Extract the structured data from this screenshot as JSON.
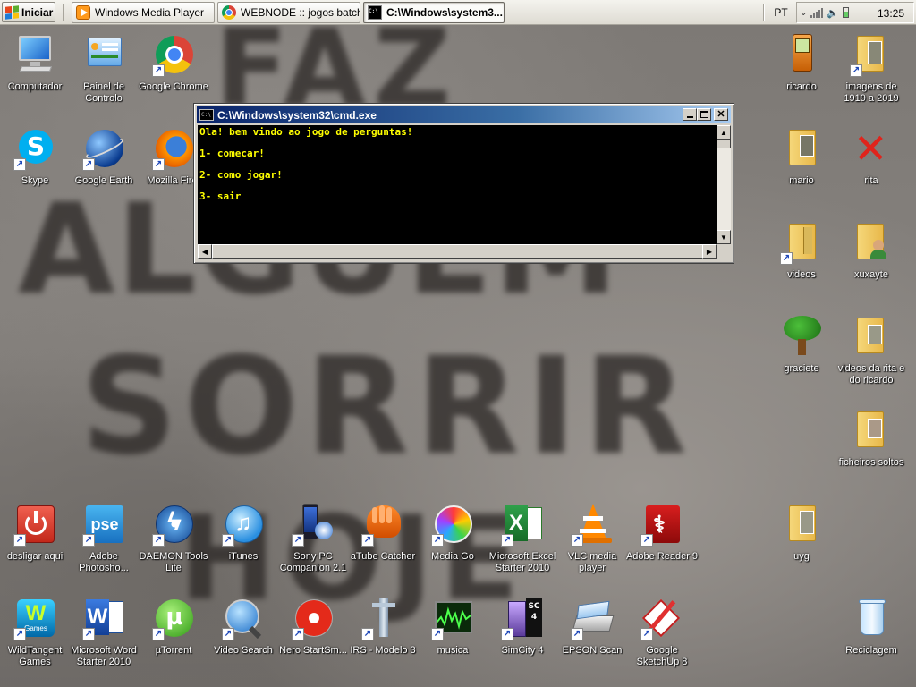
{
  "taskbar": {
    "start_label": "Iniciar",
    "tasks": [
      {
        "label": "Windows Media Player",
        "icon": "windows-media-player-icon"
      },
      {
        "label": "WEBNODE :: jogos batch...",
        "icon": "chrome-icon"
      },
      {
        "label": "C:\\Windows\\system3...",
        "icon": "cmd-icon"
      }
    ],
    "language": "PT",
    "clock": "13:25"
  },
  "wallpaper_words": [
    "FAZ",
    "ALGUEM",
    "SORRIR",
    "HOJE"
  ],
  "cmd_window": {
    "title": "C:\\Windows\\system32\\cmd.exe",
    "title_icon_text": "C:\\",
    "lines": [
      "Ola! bem vindo ao jogo de perguntas!",
      "1- comecar!",
      "2- como jogar!",
      "3- sair"
    ],
    "text_color": "#ffff00",
    "background_color": "#000000"
  },
  "desktop_icons": {
    "computador": "Computador",
    "painel": "Painel de Controlo",
    "chrome": "Google Chrome",
    "skype": "Skype",
    "earth": "Google Earth",
    "firefox": "Mozilla Firef",
    "ricardo": "ricardo",
    "imagens": "imagens de 1919 a 2019",
    "mario": "mario",
    "rita": "rita",
    "videos": "videos",
    "xuxayte": "xuxayte",
    "graciete": "graciete",
    "videos_rita": "videos da rita e do ricardo",
    "ficheiros": "ficheiros soltos",
    "uyg": "uyg",
    "desligar": "desligar aqui",
    "photoshop": "Adobe Photosho...",
    "daemon": "DAEMON Tools Lite",
    "itunes": "iTunes",
    "sony": "Sony PC Companion 2.1",
    "atube": "aTube Catcher",
    "mediago": "Media Go",
    "excel": "Microsoft Excel Starter 2010",
    "vlc": "VLC media player",
    "adobe_reader": "Adobe Reader 9",
    "wildtangent": "WildTangent Games",
    "wildtangent_badge": "Games",
    "word": "Microsoft Word Starter 2010",
    "utorrent": "µTorrent",
    "video_search": "Video Search",
    "nero": "Nero StartSm...",
    "irs": "IRS - Modelo 3",
    "musica": "musica",
    "simcity": "SimCity 4",
    "simcity_badge": "SC4",
    "epson": "EPSON Scan",
    "sketchup": "Google SketchUp 8",
    "reciclagem": "Reciclagem",
    "photoshop_badge": "pse"
  }
}
